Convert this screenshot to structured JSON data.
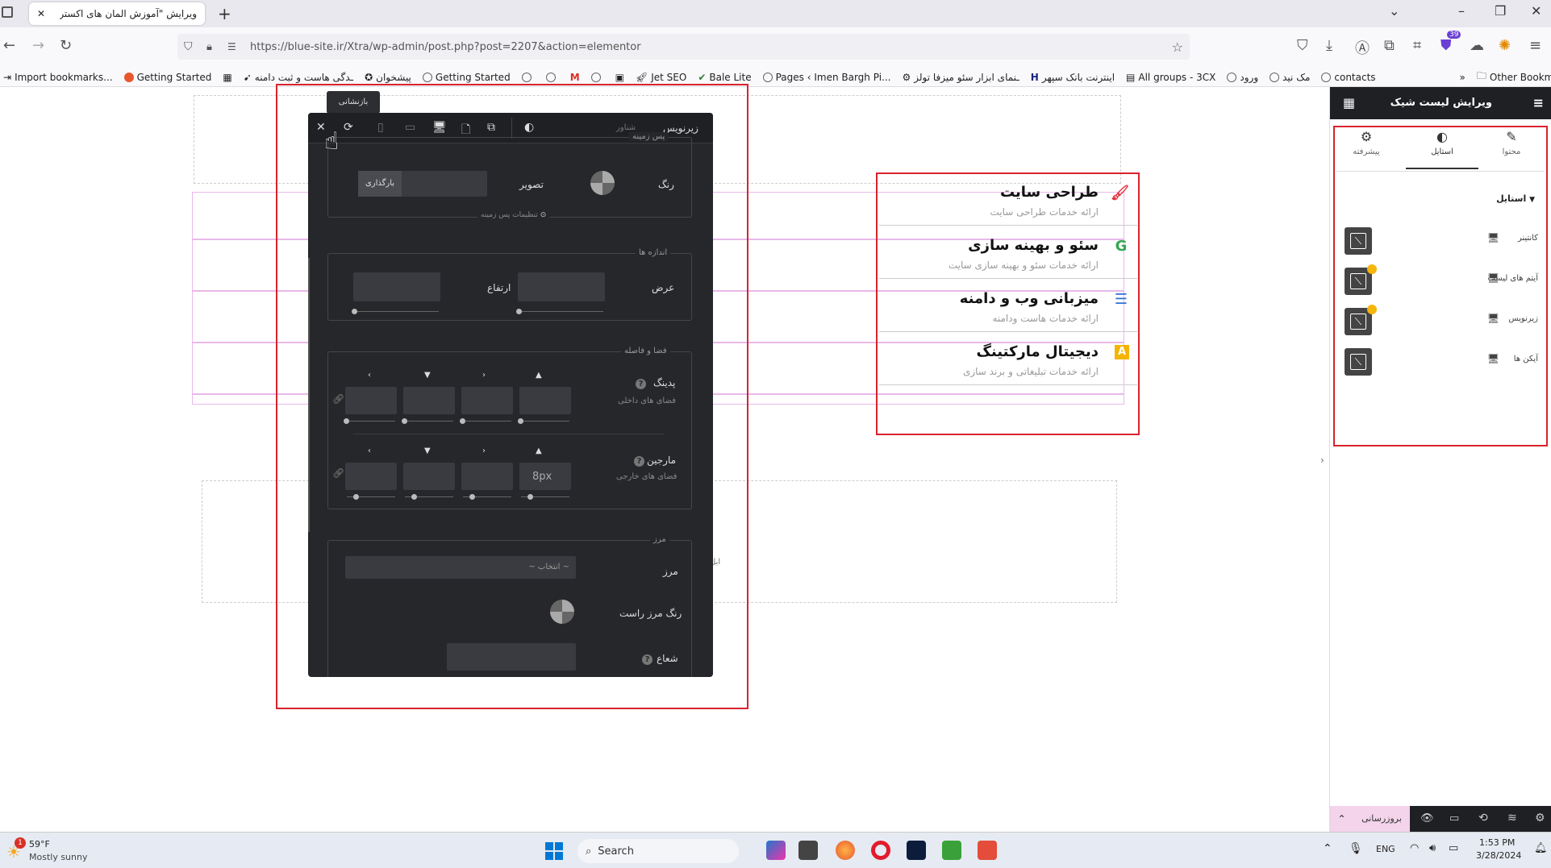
{
  "browser": {
    "tab_title": "ویرایش \"آموزش المان های اکسترا - ع",
    "url": "https://blue-site.ir/Xtra/wp-admin/post.php?post=2207&action=elementor",
    "bookmarks": [
      "Import bookmarks...",
      "Getting Started",
      "ـدگی هاست و ثبت دامنه",
      "پیشخوان",
      "Getting Started",
      "Jet SEO",
      "Bale Lite",
      "Pages ‹ Imen Bargh Pi...",
      "ـنمای ابزار سئو میزفا تولز",
      "اینترنت بانک سپهر",
      "All groups - 3CX",
      "ورود",
      "مک نید",
      "contacts"
    ],
    "other_bookmarks": "Other Bookmarks",
    "extension_badge": "39"
  },
  "services": [
    {
      "title": "طراحی سایت",
      "subtitle": "ارائه خدمات طراحی سایت",
      "icon": "brush-icon",
      "color": "#e0323c"
    },
    {
      "title": "سئو و بهینه سازی",
      "subtitle": "ارائه خدمات سئو و بهینه سازی سایت",
      "icon": "g-icon",
      "color": "#34a853"
    },
    {
      "title": "میزبانی وب و دامنه",
      "subtitle": "ارائه خدمات هاست ودامنه",
      "icon": "server-icon",
      "color": "#2f6fd6"
    },
    {
      "title": "دیجیتال مارکتینگ",
      "subtitle": "ارائه خدمات تبلیغاتی و برند سازی",
      "icon": "a-icon",
      "color": "#f4b400"
    }
  ],
  "panel": {
    "title": "زیرنویس",
    "subtitle": "شناور",
    "tooltip": "بازنشانی",
    "bg_legend": "پس زمینه",
    "bg_color_label": "رنگ",
    "bg_image_label": "تصویر",
    "bg_upload": "بارگذاری",
    "bg_settings": "تنظیمات پس زمینه",
    "size_legend": "اندازه ها",
    "width_label": "عرض",
    "height_label": "ارتفاع",
    "spacing_legend": "فضا و فاصله",
    "padding_label": "پدینگ",
    "padding_sub": "فضای های داخلی",
    "margin_label": "مارجین",
    "margin_sub": "فضای های خارجی",
    "margin_value": "8px",
    "border_legend": "مرز",
    "border_label": "مرز",
    "border_select": "~ انتخاب ~",
    "border_right_color": "رنگ مرز راست",
    "radius_label": "شعاع",
    "help": "?"
  },
  "sidebar": {
    "title": "ویرایش لیست شیک",
    "tabs": [
      {
        "label": "محتوا"
      },
      {
        "label": "استایل"
      },
      {
        "label": "پیشرفته"
      }
    ],
    "section": "استایل",
    "rows": [
      {
        "label": "کانتینر",
        "changed": false
      },
      {
        "label": "آیتم های لیست",
        "changed": true
      },
      {
        "label": "زیرنویس",
        "changed": true
      },
      {
        "label": "آیکن ها",
        "changed": false
      }
    ],
    "update_button": "بروزرسانی"
  },
  "taskbar": {
    "weather_temp": "59°F",
    "weather_text": "Mostly sunny",
    "weather_badge": "1",
    "search": "Search",
    "lang": "ENG",
    "time": "1:53 PM",
    "date": "3/28/2024"
  },
  "canvas": {
    "fragment_text": "ابل"
  }
}
